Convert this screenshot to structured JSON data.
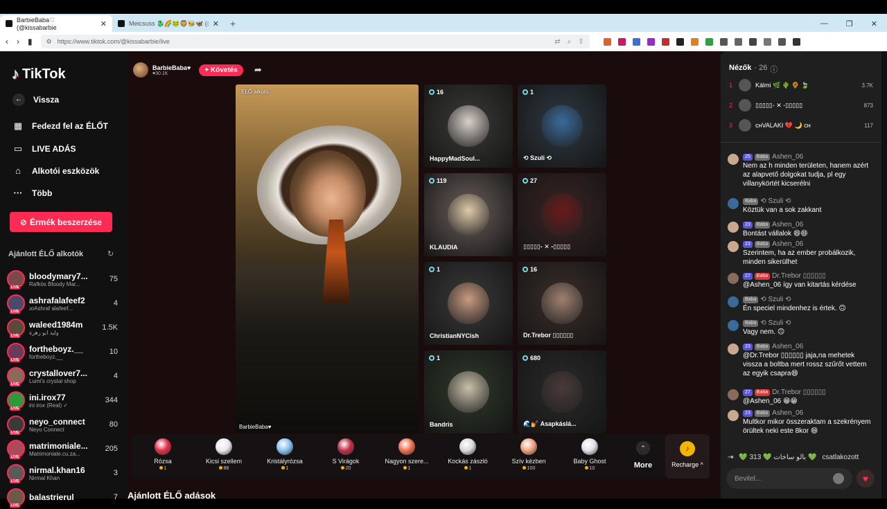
{
  "browser": {
    "tabs": [
      {
        "title": "BarbieBaba♡ (@kissabarbie"
      },
      {
        "title": "Meicsuss 🐉🌈🐸🦁🐝🦋 (@m"
      }
    ],
    "url": "https://www.tiktok.com/@kissabarbie/live"
  },
  "sidebar": {
    "logo": "TikTok",
    "back": "Vissza",
    "nav": [
      "Fedezd fel az ÉLŐT",
      "LIVE ADÁS",
      "Alkotói eszközök",
      "Több"
    ],
    "coins_button": "Érmék beszerzése",
    "suggested_title": "Ajánlott ÉLŐ alkotók",
    "creators": [
      {
        "name": "bloodymary7...",
        "sub": "Rafkós Bloody Mar...",
        "count": "75",
        "color": "#7a4a4a"
      },
      {
        "name": "ashrafalafeef2",
        "sub": "ɹoAshraf alafeef...",
        "count": "4",
        "color": "#4a4a6a"
      },
      {
        "name": "waleed1984m",
        "sub": "وليد ابو زهرة",
        "count": "1.5K",
        "color": "#5a4a3a"
      },
      {
        "name": "fortheboyz.__",
        "sub": "fortheboyz.__",
        "count": "10",
        "color": "#6a3a5a"
      },
      {
        "name": "crystallover7...",
        "sub": "Lumi's crystal shop",
        "count": "4",
        "color": "#8a6a5a"
      },
      {
        "name": "ini.irox77",
        "sub": "ini irox (Real) ✓",
        "count": "344",
        "color": "#2a9a3a"
      },
      {
        "name": "neyo_connect",
        "sub": "Neyo Connect",
        "count": "80",
        "color": "#3a3a3a"
      },
      {
        "name": "matrimoniale...",
        "sub": "Matrimoniale.cu.za...",
        "count": "205",
        "color": "#aa4a5a"
      },
      {
        "name": "nirmal.khan16",
        "sub": "Nirmal Khan",
        "count": "3",
        "color": "#5a5a5a"
      },
      {
        "name": "balastrierul",
        "sub": "",
        "count": "7",
        "color": "#6a5a4a"
      }
    ]
  },
  "stream": {
    "host_name": "BarbieBaba♥",
    "host_likes": "♥30.1K",
    "follow_label": "+ Követés",
    "main_label": "ÉLŐ alkotó",
    "main_name": "BarbieBaba♥",
    "guests": [
      {
        "count": "16",
        "name": "HappyMadSoul...",
        "bg": "#3a3a36",
        "av": "#d8d0c8"
      },
      {
        "count": "1",
        "name": "⟲ Szuli ⟲",
        "bg": "#2e3a44",
        "av": "#3a6a9a"
      },
      {
        "count": "119",
        "name": "KLAUDIA",
        "bg": "#6a5e5a",
        "av": "#e0c8a8"
      },
      {
        "count": "27",
        "name": "▯▯▯▯▯- ✕ -▯▯▯▯▯",
        "bg": "#3a2424",
        "av": "#6a1a1a"
      },
      {
        "count": "1",
        "name": "ChristianNYCish",
        "bg": "#3a3a3a",
        "av": "#c89a80"
      },
      {
        "count": "16",
        "name": "Dr.Trebor ▯▯▯▯▯▯",
        "bg": "#3a2e28",
        "av": "#a08070"
      },
      {
        "count": "1",
        "name": "Bandris",
        "bg": "#2e3a2a",
        "av": "#c8c0a8"
      },
      {
        "count": "680",
        "name": "🌊💅 Asapkáslá...",
        "bg": "#2a2a2a",
        "av": "#4a3a3a"
      }
    ]
  },
  "gifts": [
    {
      "label": "Rózsa",
      "price": "1",
      "color": "#e0304a"
    },
    {
      "label": "Kicsi szellem",
      "price": "88",
      "color": "#e8e8f0"
    },
    {
      "label": "Kristályrózsa",
      "price": "1",
      "color": "#8ac0f0"
    },
    {
      "label": "S Virágok",
      "price": "20",
      "color": "#c03048"
    },
    {
      "label": "Nagyon szere...",
      "price": "1",
      "color": "#f07050"
    },
    {
      "label": "Kockás zászló",
      "price": "1",
      "color": "#d8d8d8"
    },
    {
      "label": "Szív kézben",
      "price": "100",
      "color": "#f0a080"
    },
    {
      "label": "Baby Ghost",
      "price": "10",
      "color": "#e0e0ea"
    }
  ],
  "more_label": "More",
  "recharge_label": "Recharge ^",
  "recommended_title": "Ajánlott ÉLŐ adások",
  "viewers": {
    "title": "Nézők",
    "count": "· 26",
    "top": [
      {
        "rank": "1",
        "name": "Kálmi 🌿 🌵 🌻 🍃",
        "score": "3.7K"
      },
      {
        "rank": "2",
        "name": "▯▯▯▯▯- ✕ -▯▯▯▯▯",
        "score": "873"
      },
      {
        "rank": "3",
        "name": "ᴄʜVALAKI 💔 🌙 ᴄʜ",
        "score": "117"
      }
    ]
  },
  "chat": [
    {
      "lvl": "25",
      "fan": "Baba",
      "fanred": false,
      "user": "Ashen_06",
      "text": "Nem az h minden területen, hanem azért az alapvető dolgokat tudja, pl egy villanykörtét kicserélni",
      "av": "#c8a890"
    },
    {
      "lvl": "",
      "fan": "Baba",
      "fanred": false,
      "user": "⟲ Szuli ⟲",
      "text": "Köztük van a sok zakkant",
      "av": "#3a6a9a"
    },
    {
      "lvl": "23",
      "fan": "Baba",
      "fanred": false,
      "user": "Ashen_06",
      "text": "Bontást vállalok 😄😄",
      "av": "#c8a890"
    },
    {
      "lvl": "23",
      "fan": "Baba",
      "fanred": false,
      "user": "Ashen_06",
      "text": "Szerintem, ha az ember probálkozik, minden sikerülhet",
      "av": "#c8a890"
    },
    {
      "lvl": "27",
      "fan": "Baba",
      "fanred": true,
      "user": "Dr.Trebor ▯▯▯▯▯▯",
      "text": "@Ashen_06 így van kitartás kérdése",
      "av": "#8a6a5a"
    },
    {
      "lvl": "",
      "fan": "Baba",
      "fanred": false,
      "user": "⟲ Szuli ⟲",
      "text": "Én speciel mindenhez is értek. 🙃",
      "av": "#3a6a9a"
    },
    {
      "lvl": "",
      "fan": "Baba",
      "fanred": false,
      "user": "⟲ Szuli ⟲",
      "text": "Vagy nem. 🙃",
      "av": "#3a6a9a"
    },
    {
      "lvl": "23",
      "fan": "Baba",
      "fanred": false,
      "user": "Ashen_06",
      "text": "@Dr.Trebor ▯▯▯▯▯▯ jaja,na mehetek vissza a boltba mert rossz szűrőt vettem az egyik csapra😄",
      "av": "#c8a890"
    },
    {
      "lvl": "27",
      "fan": "Baba",
      "fanred": true,
      "user": "Dr.Trebor ▯▯▯▯▯▯",
      "text": "@Ashen_06 😁😁",
      "av": "#8a6a5a"
    },
    {
      "lvl": "23",
      "fan": "Baba",
      "fanred": false,
      "user": "Ashen_06",
      "text": "Multkor mikor összeraktam a szekrényem örültek neki este 8kor 😄",
      "av": "#c8a890"
    }
  ],
  "join": {
    "text": "💚 313 💚 بالو ساخات 💚",
    "action": "csatlakozott"
  },
  "input_placeholder": "Bevitel..."
}
